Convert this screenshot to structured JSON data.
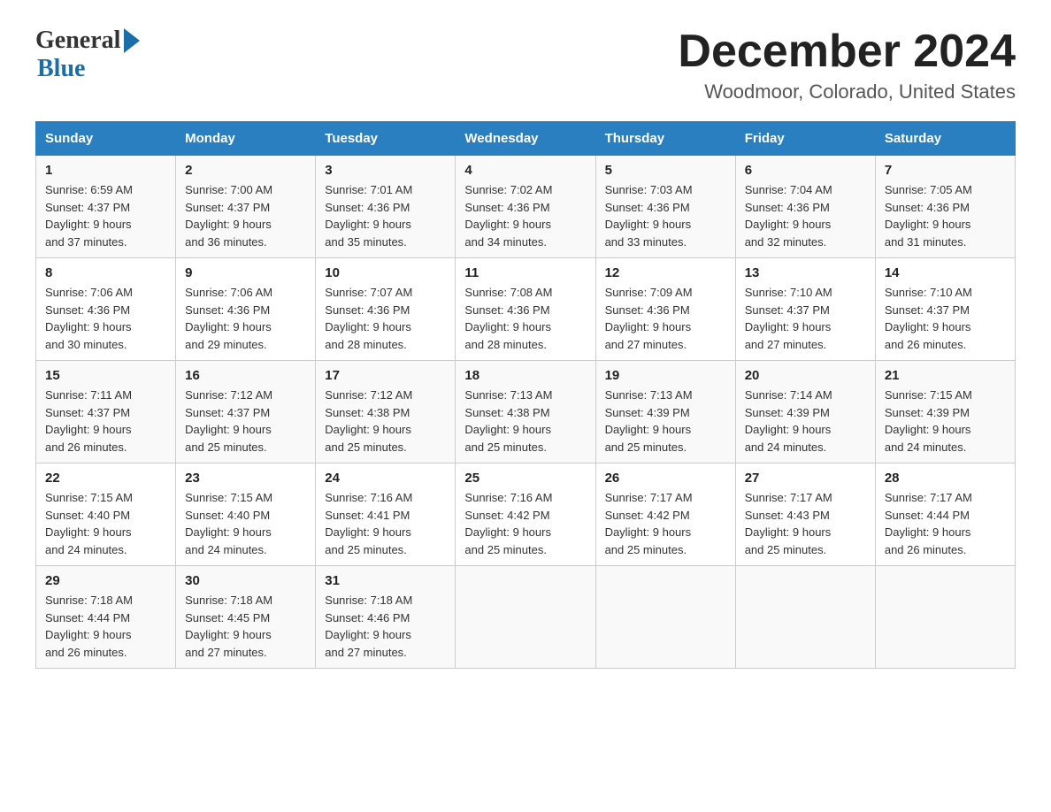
{
  "logo": {
    "general": "General",
    "blue": "Blue"
  },
  "title": "December 2024",
  "subtitle": "Woodmoor, Colorado, United States",
  "headers": [
    "Sunday",
    "Monday",
    "Tuesday",
    "Wednesday",
    "Thursday",
    "Friday",
    "Saturday"
  ],
  "weeks": [
    [
      {
        "day": "1",
        "sunrise": "6:59 AM",
        "sunset": "4:37 PM",
        "daylight": "9 hours and 37 minutes."
      },
      {
        "day": "2",
        "sunrise": "7:00 AM",
        "sunset": "4:37 PM",
        "daylight": "9 hours and 36 minutes."
      },
      {
        "day": "3",
        "sunrise": "7:01 AM",
        "sunset": "4:36 PM",
        "daylight": "9 hours and 35 minutes."
      },
      {
        "day": "4",
        "sunrise": "7:02 AM",
        "sunset": "4:36 PM",
        "daylight": "9 hours and 34 minutes."
      },
      {
        "day": "5",
        "sunrise": "7:03 AM",
        "sunset": "4:36 PM",
        "daylight": "9 hours and 33 minutes."
      },
      {
        "day": "6",
        "sunrise": "7:04 AM",
        "sunset": "4:36 PM",
        "daylight": "9 hours and 32 minutes."
      },
      {
        "day": "7",
        "sunrise": "7:05 AM",
        "sunset": "4:36 PM",
        "daylight": "9 hours and 31 minutes."
      }
    ],
    [
      {
        "day": "8",
        "sunrise": "7:06 AM",
        "sunset": "4:36 PM",
        "daylight": "9 hours and 30 minutes."
      },
      {
        "day": "9",
        "sunrise": "7:06 AM",
        "sunset": "4:36 PM",
        "daylight": "9 hours and 29 minutes."
      },
      {
        "day": "10",
        "sunrise": "7:07 AM",
        "sunset": "4:36 PM",
        "daylight": "9 hours and 28 minutes."
      },
      {
        "day": "11",
        "sunrise": "7:08 AM",
        "sunset": "4:36 PM",
        "daylight": "9 hours and 28 minutes."
      },
      {
        "day": "12",
        "sunrise": "7:09 AM",
        "sunset": "4:36 PM",
        "daylight": "9 hours and 27 minutes."
      },
      {
        "day": "13",
        "sunrise": "7:10 AM",
        "sunset": "4:37 PM",
        "daylight": "9 hours and 27 minutes."
      },
      {
        "day": "14",
        "sunrise": "7:10 AM",
        "sunset": "4:37 PM",
        "daylight": "9 hours and 26 minutes."
      }
    ],
    [
      {
        "day": "15",
        "sunrise": "7:11 AM",
        "sunset": "4:37 PM",
        "daylight": "9 hours and 26 minutes."
      },
      {
        "day": "16",
        "sunrise": "7:12 AM",
        "sunset": "4:37 PM",
        "daylight": "9 hours and 25 minutes."
      },
      {
        "day": "17",
        "sunrise": "7:12 AM",
        "sunset": "4:38 PM",
        "daylight": "9 hours and 25 minutes."
      },
      {
        "day": "18",
        "sunrise": "7:13 AM",
        "sunset": "4:38 PM",
        "daylight": "9 hours and 25 minutes."
      },
      {
        "day": "19",
        "sunrise": "7:13 AM",
        "sunset": "4:39 PM",
        "daylight": "9 hours and 25 minutes."
      },
      {
        "day": "20",
        "sunrise": "7:14 AM",
        "sunset": "4:39 PM",
        "daylight": "9 hours and 24 minutes."
      },
      {
        "day": "21",
        "sunrise": "7:15 AM",
        "sunset": "4:39 PM",
        "daylight": "9 hours and 24 minutes."
      }
    ],
    [
      {
        "day": "22",
        "sunrise": "7:15 AM",
        "sunset": "4:40 PM",
        "daylight": "9 hours and 24 minutes."
      },
      {
        "day": "23",
        "sunrise": "7:15 AM",
        "sunset": "4:40 PM",
        "daylight": "9 hours and 24 minutes."
      },
      {
        "day": "24",
        "sunrise": "7:16 AM",
        "sunset": "4:41 PM",
        "daylight": "9 hours and 25 minutes."
      },
      {
        "day": "25",
        "sunrise": "7:16 AM",
        "sunset": "4:42 PM",
        "daylight": "9 hours and 25 minutes."
      },
      {
        "day": "26",
        "sunrise": "7:17 AM",
        "sunset": "4:42 PM",
        "daylight": "9 hours and 25 minutes."
      },
      {
        "day": "27",
        "sunrise": "7:17 AM",
        "sunset": "4:43 PM",
        "daylight": "9 hours and 25 minutes."
      },
      {
        "day": "28",
        "sunrise": "7:17 AM",
        "sunset": "4:44 PM",
        "daylight": "9 hours and 26 minutes."
      }
    ],
    [
      {
        "day": "29",
        "sunrise": "7:18 AM",
        "sunset": "4:44 PM",
        "daylight": "9 hours and 26 minutes."
      },
      {
        "day": "30",
        "sunrise": "7:18 AM",
        "sunset": "4:45 PM",
        "daylight": "9 hours and 27 minutes."
      },
      {
        "day": "31",
        "sunrise": "7:18 AM",
        "sunset": "4:46 PM",
        "daylight": "9 hours and 27 minutes."
      },
      null,
      null,
      null,
      null
    ]
  ],
  "labels": {
    "sunrise": "Sunrise:",
    "sunset": "Sunset:",
    "daylight": "Daylight:"
  }
}
